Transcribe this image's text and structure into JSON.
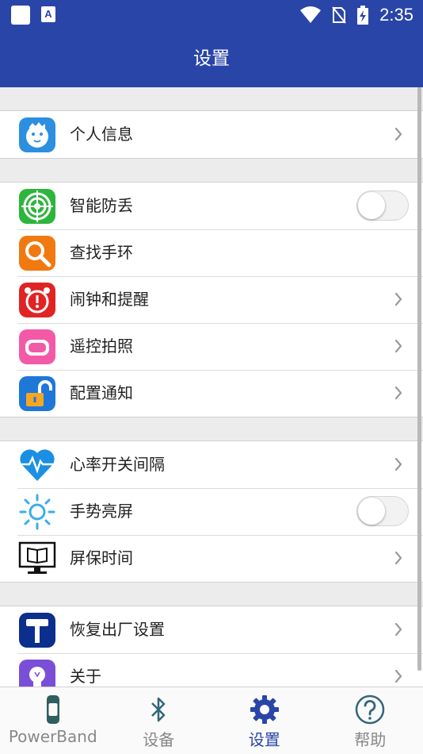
{
  "status_bar": {
    "time": "2:35"
  },
  "header": {
    "title": "设置"
  },
  "groups": [
    {
      "rows": [
        {
          "label": "个人信息",
          "icon": "profile-avatar-icon",
          "control": "chevron"
        }
      ]
    },
    {
      "rows": [
        {
          "label": "智能防丢",
          "icon": "target-icon",
          "control": "toggle",
          "toggle_on": false
        },
        {
          "label": "查找手环",
          "icon": "magnifier-icon",
          "control": "none"
        },
        {
          "label": "闹钟和提醒",
          "icon": "alarm-clock-icon",
          "control": "chevron"
        },
        {
          "label": "遥控拍照",
          "icon": "camera-remote-icon",
          "control": "chevron"
        },
        {
          "label": "配置通知",
          "icon": "unlock-icon",
          "control": "chevron"
        }
      ]
    },
    {
      "rows": [
        {
          "label": "心率开关间隔",
          "icon": "heart-rate-icon",
          "control": "chevron"
        },
        {
          "label": "手势亮屏",
          "icon": "sun-icon",
          "control": "toggle",
          "toggle_on": false
        },
        {
          "label": "屏保时间",
          "icon": "monitor-book-icon",
          "control": "chevron"
        }
      ]
    },
    {
      "rows": [
        {
          "label": "恢复出厂设置",
          "icon": "hammer-icon",
          "control": "chevron"
        },
        {
          "label": "关于",
          "icon": "lightbulb-icon",
          "control": "chevron"
        }
      ]
    }
  ],
  "tabs": [
    {
      "label": "PowerBand",
      "icon": "band-icon",
      "active": false
    },
    {
      "label": "设备",
      "icon": "bluetooth-icon",
      "active": false
    },
    {
      "label": "设置",
      "icon": "gear-icon",
      "active": true
    },
    {
      "label": "帮助",
      "icon": "help-icon",
      "active": false
    }
  ],
  "colors": {
    "primary": "#2a45a8",
    "inactive_tab": "#888888"
  }
}
